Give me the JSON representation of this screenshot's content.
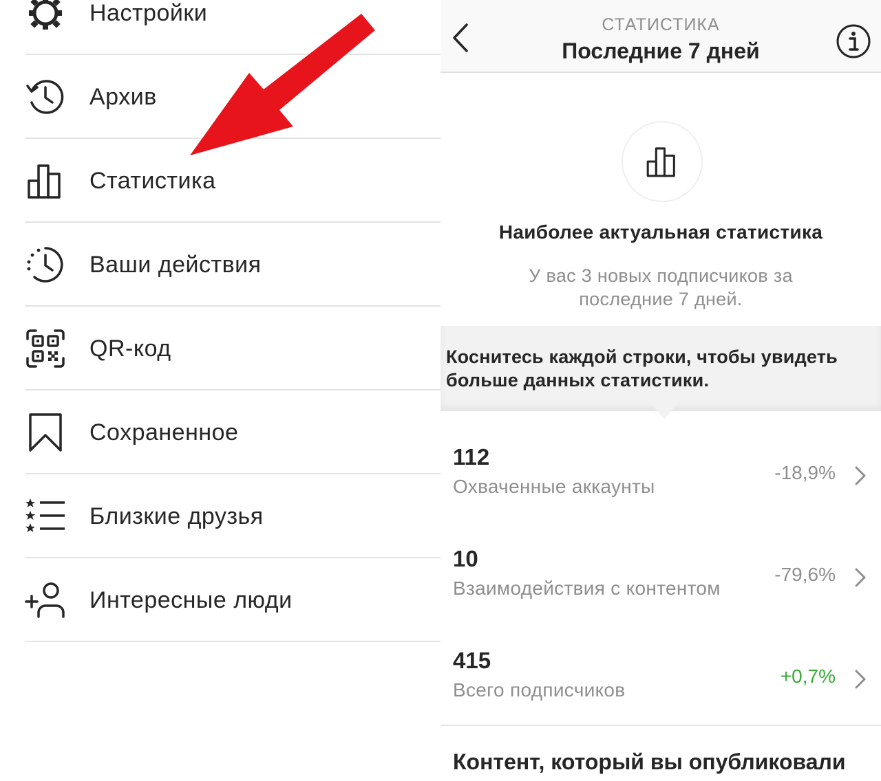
{
  "menu": {
    "items": [
      {
        "label": "Настройки",
        "icon": "gear-icon"
      },
      {
        "label": "Архив",
        "icon": "archive-history-icon"
      },
      {
        "label": "Статистика",
        "icon": "bar-chart-icon"
      },
      {
        "label": "Ваши действия",
        "icon": "activity-clock-icon"
      },
      {
        "label": "QR-код",
        "icon": "qr-code-icon"
      },
      {
        "label": "Сохраненное",
        "icon": "bookmark-icon"
      },
      {
        "label": "Близкие друзья",
        "icon": "close-friends-list-icon"
      },
      {
        "label": "Интересные люди",
        "icon": "add-person-icon"
      }
    ]
  },
  "annotation": {
    "arrow_color": "#e8141c"
  },
  "nav": {
    "subtitle": "СТАТИСТИКА",
    "title": "Последние 7 дней"
  },
  "hero": {
    "title": "Наиболее актуальная статистика",
    "text": "У вас 3 новых подписчиков за последние 7 дней."
  },
  "tip": {
    "text": "Коснитесь каждой строки, чтобы увидеть больше данных статистики."
  },
  "stats": [
    {
      "value": "112",
      "label": "Охваченные аккаунты",
      "change": "-18,9%",
      "positive": false
    },
    {
      "value": "10",
      "label": "Взаимодействия с контентом",
      "change": "-79,6%",
      "positive": false
    },
    {
      "value": "415",
      "label": "Всего подписчиков",
      "change": "+0,7%",
      "positive": true
    }
  ],
  "content_section": {
    "title": "Контент, который вы опубликовали"
  },
  "colors": {
    "positive": "#3aaa35",
    "muted": "#8e8e8e",
    "text": "#262626"
  }
}
